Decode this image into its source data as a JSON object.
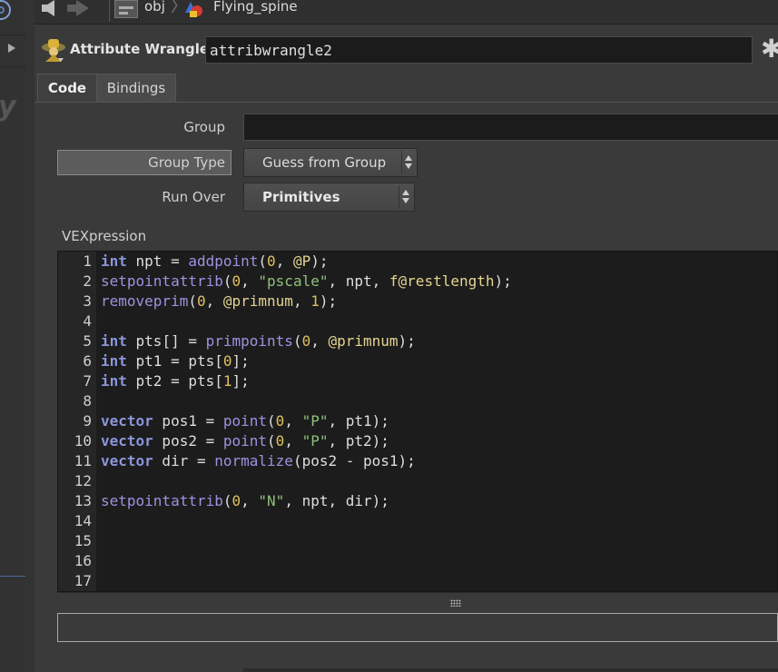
{
  "nav": {
    "path_root": "obj",
    "path_node": "Flying_spine"
  },
  "node": {
    "type_label": "Attribute Wrangle",
    "name": "attribwrangle2"
  },
  "tabs": [
    {
      "label": "Code"
    },
    {
      "label": "Bindings"
    }
  ],
  "params": {
    "group_label": "Group",
    "group_value": "",
    "group_type_label": "Group Type",
    "group_type_value": "Guess from Group",
    "run_over_label": "Run Over",
    "run_over_value": "Primitives",
    "vexpression_label": "VEXpression"
  },
  "code_lines": [
    {
      "num": "1",
      "text": "int npt = addpoint(0, @P);"
    },
    {
      "num": "2",
      "text": "setpointattrib(0, \"pscale\", npt, f@restlength);"
    },
    {
      "num": "3",
      "text": "removeprim(0, @primnum, 1);"
    },
    {
      "num": "4",
      "text": ""
    },
    {
      "num": "5",
      "text": "int pts[] = primpoints(0, @primnum);"
    },
    {
      "num": "6",
      "text": "int pt1 = pts[0];"
    },
    {
      "num": "7",
      "text": "int pt2 = pts[1];"
    },
    {
      "num": "8",
      "text": ""
    },
    {
      "num": "9",
      "text": "vector pos1 = point(0, \"P\", pt1);"
    },
    {
      "num": "10",
      "text": "vector pos2 = point(0, \"P\", pt2);"
    },
    {
      "num": "11",
      "text": "vector dir = normalize(pos2 - pos1);"
    },
    {
      "num": "12",
      "text": ""
    },
    {
      "num": "13",
      "text": "setpointattrib(0, \"N\", npt, dir);"
    },
    {
      "num": "14",
      "text": ""
    },
    {
      "num": "15",
      "text": ""
    },
    {
      "num": "16",
      "text": ""
    },
    {
      "num": "17",
      "text": ""
    }
  ],
  "colors": {
    "keyword": "#8b95d8",
    "function": "#a190e0",
    "number": "#e0c060",
    "string": "#8fc07a",
    "attribute": "#e4d590"
  }
}
